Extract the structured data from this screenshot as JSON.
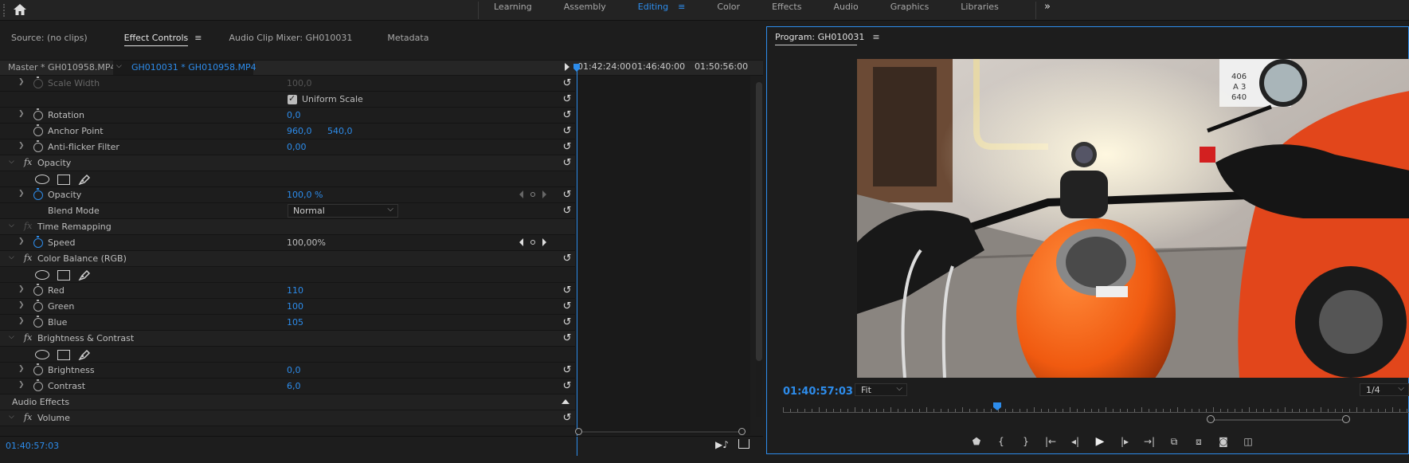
{
  "workspaces": {
    "tabs": [
      "Learning",
      "Assembly",
      "Editing",
      "Color",
      "Effects",
      "Audio",
      "Graphics",
      "Libraries"
    ],
    "active": "Editing",
    "more": "»"
  },
  "left_tabs": {
    "source": "Source: (no clips)",
    "effect_controls": "Effect Controls",
    "audio_mixer": "Audio Clip Mixer: GH010031",
    "metadata": "Metadata"
  },
  "clip": {
    "master": "Master * GH010958.MP4",
    "selected": "GH010031 * GH010958.MP4"
  },
  "ruler": [
    "01:42:24:00",
    "01:46:40:00",
    "01:50:56:00"
  ],
  "effect_rows": {
    "scale_width": {
      "name": "Scale Width",
      "value": "100,0"
    },
    "uniform_scale": "Uniform Scale",
    "rotation": {
      "name": "Rotation",
      "value": "0,0"
    },
    "anchor_point": {
      "name": "Anchor Point",
      "x": "960,0",
      "y": "540,0"
    },
    "anti_flicker": {
      "name": "Anti-flicker Filter",
      "value": "0,00"
    },
    "opacity_section": "Opacity",
    "opacity": {
      "name": "Opacity",
      "value": "100,0 %"
    },
    "blend_mode": {
      "name": "Blend Mode",
      "value": "Normal"
    },
    "time_remapping": "Time Remapping",
    "speed": {
      "name": "Speed",
      "value": "100,00%"
    },
    "color_balance": "Color Balance (RGB)",
    "red": {
      "name": "Red",
      "value": "110"
    },
    "green": {
      "name": "Green",
      "value": "100"
    },
    "blue": {
      "name": "Blue",
      "value": "105"
    },
    "brightness_contrast": "Brightness & Contrast",
    "brightness": {
      "name": "Brightness",
      "value": "0,0"
    },
    "contrast": {
      "name": "Contrast",
      "value": "6,0"
    },
    "audio_effects": "Audio Effects",
    "volume": "Volume"
  },
  "fx_label": "fx",
  "footer_timecode": "01:40:57:03",
  "program": {
    "title": "Program: GH010031",
    "timecode": "01:40:57:03",
    "fit": "Fit",
    "resolution": "1/4"
  },
  "icons": {
    "home": "home-icon",
    "reset": "reset-icon",
    "stopwatch": "stopwatch-icon"
  },
  "colors": {
    "accent": "#2d8ceb",
    "background": "#1d1d1d"
  }
}
